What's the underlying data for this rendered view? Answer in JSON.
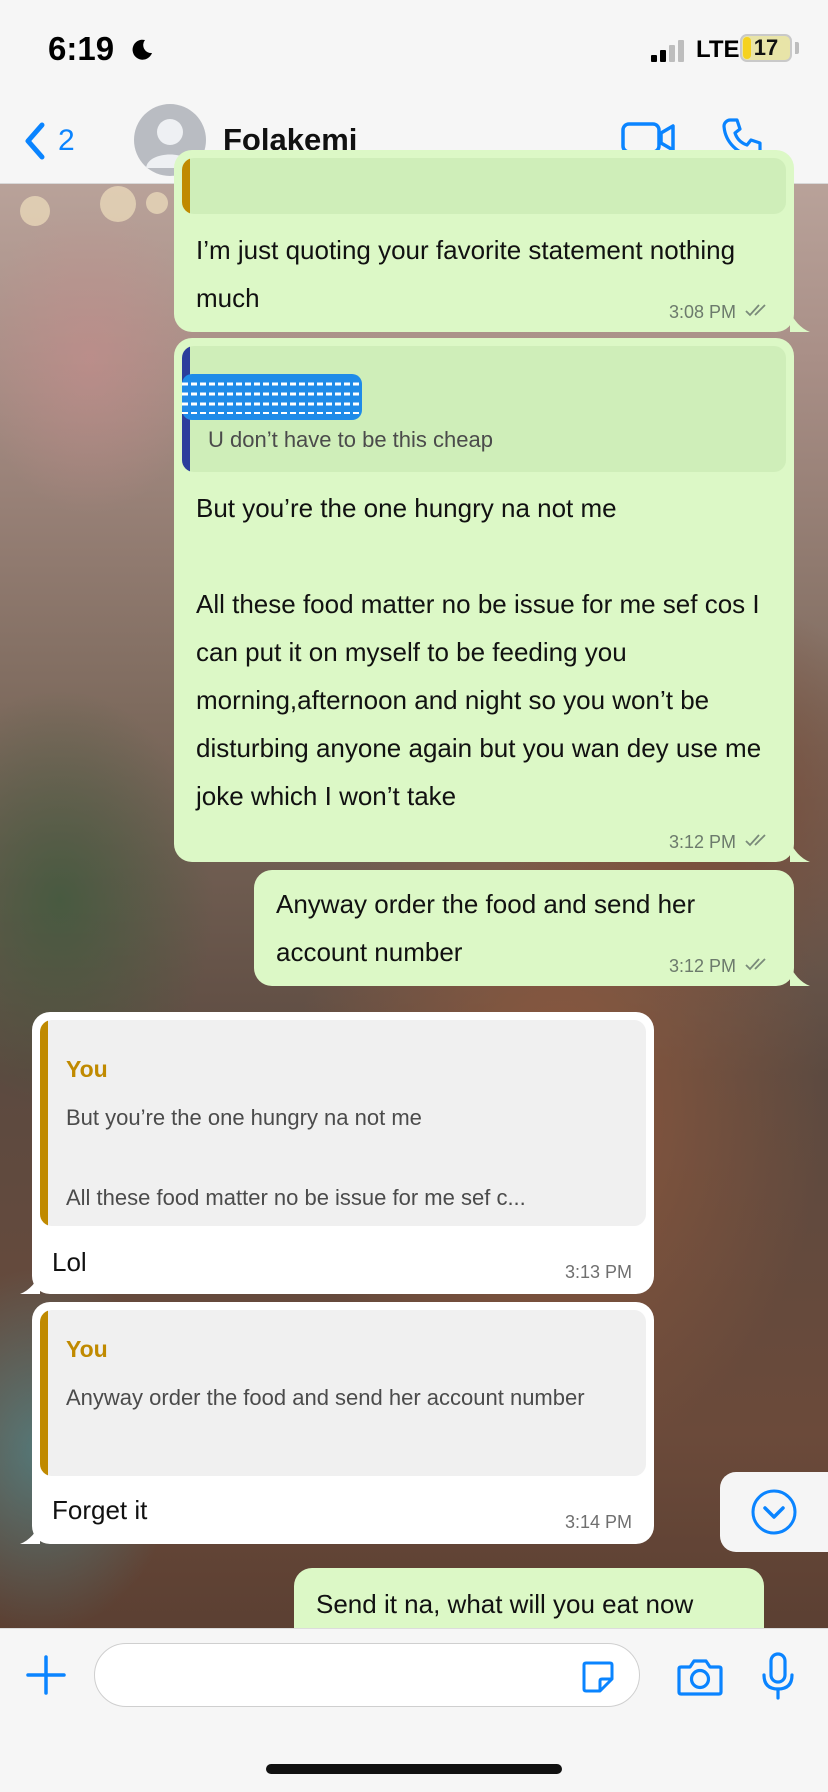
{
  "status_bar": {
    "time": "6:19",
    "network": "LTE",
    "battery": "17",
    "battery_level": 0.17
  },
  "header": {
    "back_count": "2",
    "contact_name": "Folakemi"
  },
  "messages": [
    {
      "direction": "outgoing",
      "text": "I’m just quoting your favorite statement nothing much",
      "time": "3:08 PM"
    },
    {
      "direction": "outgoing",
      "quote": {
        "text": "U don’t have to be this cheap"
      },
      "text": "But you’re the one hungry na not me\n\nAll these food matter no be issue for me sef cos I can put it on myself to be feeding you morning,afternoon and night so you won’t be disturbing anyone again but you wan dey use me joke which I won’t take",
      "time": "3:12 PM"
    },
    {
      "direction": "outgoing",
      "text": "Anyway order the food and send her account number",
      "time": "3:12 PM"
    },
    {
      "direction": "incoming",
      "quote": {
        "author": "You",
        "text": "But you’re the one hungry na not me\n\nAll these food matter no be issue for me sef c..."
      },
      "text": "Lol",
      "time": "3:13 PM"
    },
    {
      "direction": "incoming",
      "quote": {
        "author": "You",
        "text": "Anyway order the food and send her account number"
      },
      "text": "Forget it",
      "time": "3:14 PM"
    },
    {
      "direction": "outgoing",
      "text": "Send it na, what will you eat now"
    }
  ],
  "input": {
    "value": ""
  },
  "colors": {
    "outgoing_bubble": "#dcf8c6",
    "incoming_bubble": "#ffffff",
    "quote_author": "#c08a00",
    "accent": "#0a84ff",
    "quote_bar_navy": "#2c3e9c",
    "quote_bar_gold": "#c08a00"
  },
  "icons": [
    "moon-icon",
    "signal-icon",
    "back-chevron-icon",
    "video-call-icon",
    "phone-icon",
    "double-check-icon",
    "chevron-down-icon",
    "plus-icon",
    "sticker-icon",
    "camera-icon",
    "microphone-icon"
  ]
}
